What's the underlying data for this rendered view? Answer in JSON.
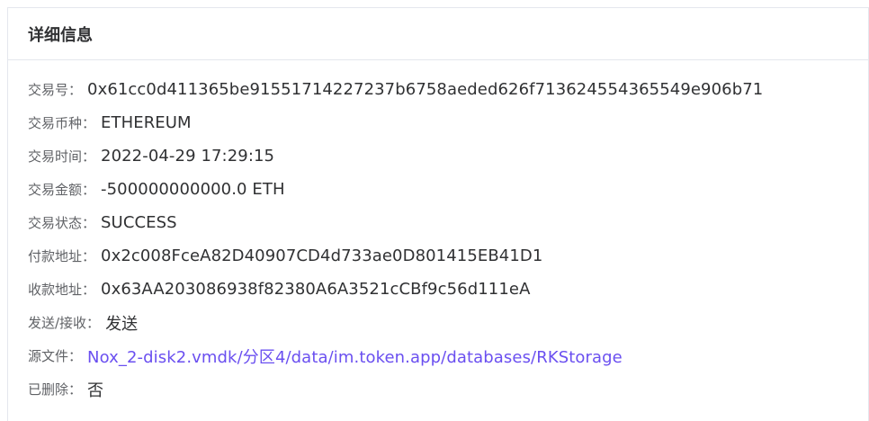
{
  "panel": {
    "title": "详细信息"
  },
  "fields": [
    {
      "label": "交易号：",
      "value": "0x61cc0d411365be91551714227237b6758aeded626f713624554365549e906b71"
    },
    {
      "label": "交易币种：",
      "value": "ETHEREUM"
    },
    {
      "label": "交易时间：",
      "value": "2022-04-29 17:29:15"
    },
    {
      "label": "交易金额：",
      "value": "-500000000000.0 ETH"
    },
    {
      "label": "交易状态：",
      "value": "SUCCESS"
    },
    {
      "label": "付款地址：",
      "value": "0x2c008FceA82D40907CD4d733ae0D801415EB41D1"
    },
    {
      "label": "收款地址：",
      "value": "0x63AA203086938f82380A6A3521cCBf9c56d111eA"
    },
    {
      "label": "发送/接收：",
      "value": "发送"
    },
    {
      "label": "源文件：",
      "value": "Nox_2-disk2.vmdk/分区4/data/im.token.app/databases/RKStorage"
    },
    {
      "label": "已删除：",
      "value": "否"
    }
  ],
  "colors": {
    "link": "#6a4ff0",
    "border": "#e4e7ed"
  }
}
